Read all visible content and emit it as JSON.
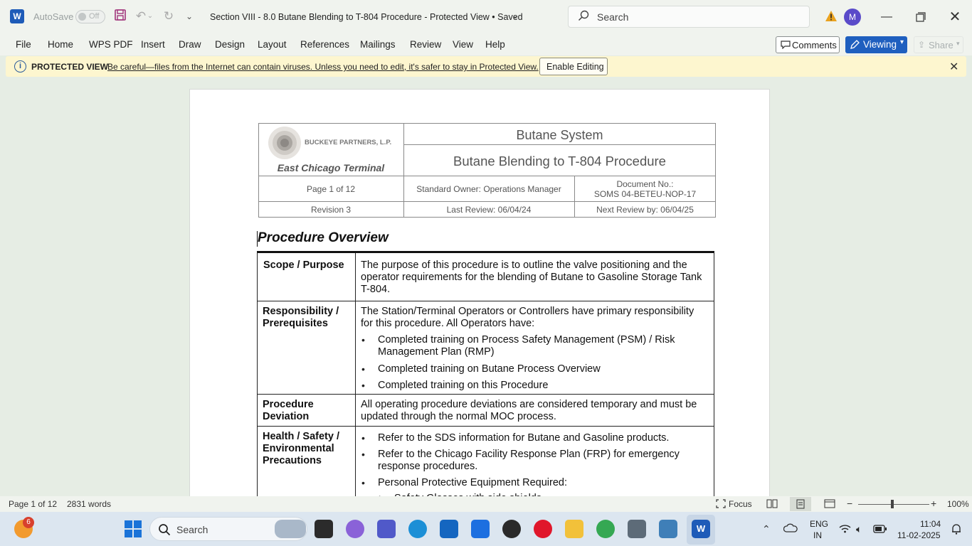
{
  "titlebar": {
    "autosave_label": "AutoSave",
    "autosave_state": "Off",
    "document_title": "Section VIII - 8.0 Butane Blending to T-804 Procedure  -  Protected View • Saved",
    "search_placeholder": "Search",
    "avatar_initial": "M"
  },
  "menu": {
    "items": [
      "File",
      "Home",
      "WPS PDF",
      "Insert",
      "Draw",
      "Design",
      "Layout",
      "References",
      "Mailings",
      "Review",
      "View",
      "Help"
    ],
    "comments": "Comments",
    "viewing": "Viewing",
    "share": "Share"
  },
  "protected_view": {
    "title": "PROTECTED VIEW",
    "message": "Be careful—files from the Internet can contain viruses. Unless you need to edit, it's safer to stay in Protected View.",
    "enable_button": "Enable Editing"
  },
  "doc_header": {
    "company": "BUCKEYE PARTNERS, L.P.",
    "terminal": "East Chicago Terminal",
    "system": "Butane System",
    "procedure": "Butane Blending to T-804 Procedure",
    "page": "Page 1 of 12",
    "owner": "Standard Owner: Operations Manager",
    "doc_no_label": "Document No.:",
    "doc_no": "SOMS 04-BETEU-NOP-17",
    "revision": "Revision 3",
    "last_review": "Last Review: 06/04/24",
    "next_review": "Next Review by: 06/04/25"
  },
  "document": {
    "heading": "Procedure Overview",
    "rows": {
      "scope_label": "Scope / Purpose",
      "scope_text": [
        "The purpose of this procedure is to outline the valve positioning and the",
        "operator requirements for the blending of Butane to Gasoline Storage Tank",
        "T-804."
      ],
      "resp_label": [
        "Responsibility /",
        "Prerequisites"
      ],
      "resp_text": [
        "The Station/Terminal Operators or Controllers have primary responsibility",
        "for this procedure.  All Operators have:"
      ],
      "resp_b1": [
        "Completed training on Process Safety Management (PSM) / Risk",
        "Management Plan (RMP)"
      ],
      "resp_b2": "Completed training on Butane Process Overview",
      "resp_b3": "Completed training on this Procedure",
      "dev_label": [
        "Procedure",
        "Deviation"
      ],
      "dev_text": [
        "All operating procedure deviations are considered temporary and must be",
        "updated through the normal MOC process."
      ],
      "hse_label": [
        "Health / Safety /",
        "Environmental",
        "Precautions"
      ],
      "hse_b1": "Refer to the SDS information for Butane and Gasoline products.",
      "hse_b2": [
        "Refer to the Chicago Facility Response Plan (FRP) for emergency",
        "response procedures."
      ],
      "hse_b3": "Personal Protective Equipment Required:",
      "hse_sub": "Safety Glasses with side shields"
    }
  },
  "statusbar": {
    "page": "Page 1 of 12",
    "words": "2831 words",
    "focus": "Focus",
    "zoom": "100%"
  },
  "taskbar": {
    "search": "Search",
    "widget_badge": "6",
    "lang1": "ENG",
    "lang2": "IN",
    "time": "11:04",
    "date": "11-02-2025"
  }
}
